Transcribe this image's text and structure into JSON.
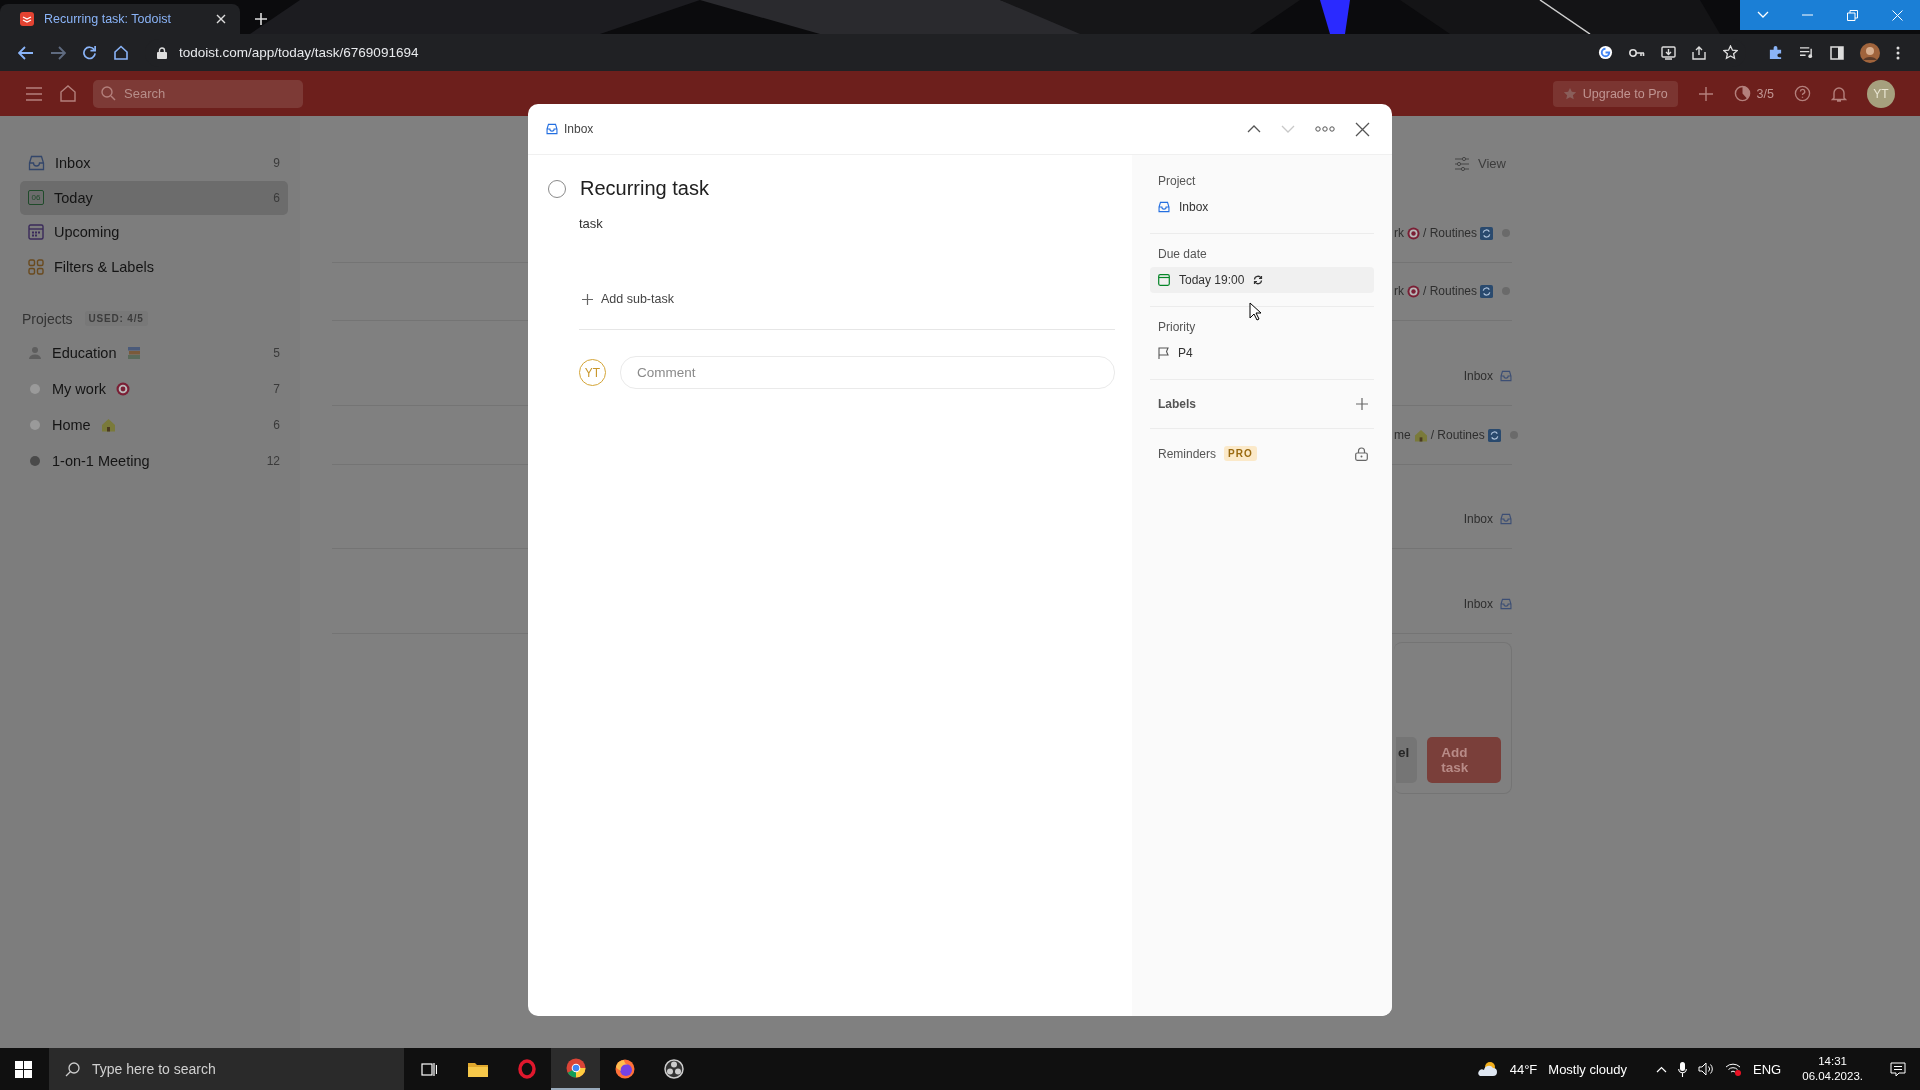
{
  "browser": {
    "tabs": [
      {
        "title": "Recurring task: Todoist",
        "selected": true
      }
    ],
    "url": "todoist.com/app/today/task/6769091694"
  },
  "app_bar": {
    "search": {
      "placeholder": "Search"
    },
    "upgrade_button": "Upgrade to Pro",
    "karma": "3/5",
    "avatar": "YT"
  },
  "sidebar": {
    "items": [
      {
        "label": "Inbox",
        "count": "9",
        "kind": "inbox",
        "selected": false
      },
      {
        "label": "Today",
        "count": "6",
        "kind": "today",
        "icon_text": "06",
        "selected": true
      },
      {
        "label": "Upcoming",
        "kind": "upcoming",
        "selected": false
      },
      {
        "label": "Filters & Labels",
        "kind": "filters",
        "selected": false
      }
    ],
    "projects": {
      "heading": "Projects",
      "badge": "USED: 4/5",
      "items": [
        {
          "name": "Education",
          "count": "5",
          "kind": "person"
        },
        {
          "name": "My work",
          "count": "7",
          "kind": "dot",
          "color": "#9a9a9a"
        },
        {
          "name": "Home",
          "count": "6",
          "kind": "dot",
          "color": "#9a9a9a"
        },
        {
          "name": "1-on-1 Meeting",
          "count": "12",
          "kind": "dot",
          "color": "#4a4a4a"
        }
      ]
    }
  },
  "task_list": {
    "view_button": "View",
    "rows": [
      {
        "kind": "work",
        "project": "rk",
        "section": "/ Routines"
      },
      {
        "kind": "work",
        "project": "rk",
        "section": "/ Routines"
      },
      {
        "kind": "inbox",
        "project": "Inbox"
      },
      {
        "kind": "home",
        "project": "me",
        "section": "/ Routines"
      },
      {
        "kind": "inbox",
        "project": "Inbox"
      },
      {
        "kind": "inbox",
        "project": "Inbox"
      }
    ],
    "cancel_button": "el",
    "add_task_button": "Add task"
  },
  "task_dialog": {
    "breadcrumb": "Inbox",
    "next_disabled": true,
    "title": "Recurring task",
    "completed": false,
    "description": "task",
    "add_subtask": "Add sub-task",
    "comment": {
      "avatar": "YT",
      "placeholder": "Comment"
    },
    "details": {
      "project_label": "Project",
      "project": "Inbox",
      "due_label": "Due date",
      "due": "Today 19:00",
      "recurring": true,
      "priority_label": "Priority",
      "priority": "P4",
      "labels_label": "Labels",
      "reminders_label": "Reminders",
      "reminders_badge": "PRO",
      "reminders_locked": true
    }
  },
  "taskbar": {
    "search": {
      "placeholder": "Type here to search"
    },
    "apps": [
      {
        "kind": "taskview",
        "selected": false
      },
      {
        "kind": "folder",
        "selected": false
      },
      {
        "kind": "ring",
        "selected": false
      },
      {
        "kind": "chrome",
        "selected": true
      },
      {
        "kind": "firefox",
        "selected": false
      },
      {
        "kind": "aperture",
        "selected": false
      }
    ],
    "weather": {
      "temperature": "44°F",
      "condition": "Mostly cloudy"
    },
    "language": "ENG",
    "time": "14:31",
    "date": "06.04.2023."
  }
}
